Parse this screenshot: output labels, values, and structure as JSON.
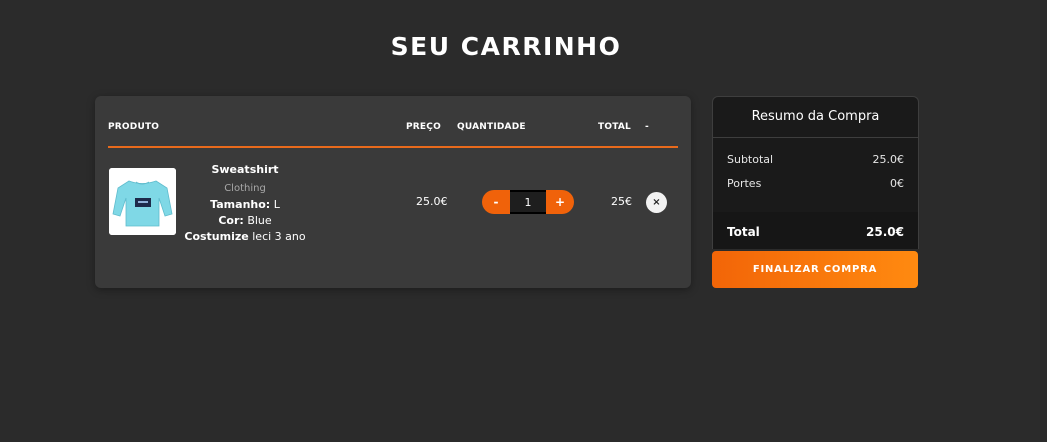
{
  "page": {
    "title": "SEU CARRINHO"
  },
  "cart": {
    "columns": {
      "produto": "PRODUTO",
      "preco": "PREÇO",
      "quantidade": "QUANTIDADE",
      "total": "TOTAL",
      "remove": "-"
    },
    "items": [
      {
        "name": "Sweatshirt",
        "category": "Clothing",
        "size_label": "Tamanho:",
        "size": "L",
        "color_label": "Cor:",
        "color": "Blue",
        "custom_label": "Costumize",
        "custom": "leci 3 ano",
        "price": "25.0€",
        "quantity": "1",
        "minus": "-",
        "plus": "+",
        "total": "25€",
        "remove": "×"
      }
    ]
  },
  "summary": {
    "title": "Resumo da Compra",
    "subtotal_label": "Subtotal",
    "subtotal_value": "25.0€",
    "portes_label": "Portes",
    "portes_value": "0€",
    "total_label": "Total",
    "total_value": "25.0€",
    "checkout_label": "FINALIZAR COMPRA"
  },
  "colors": {
    "accent": "#f0620a",
    "background": "#2b2b2b",
    "panel": "#3a3a3a",
    "summary_panel": "#1a1a1a"
  }
}
